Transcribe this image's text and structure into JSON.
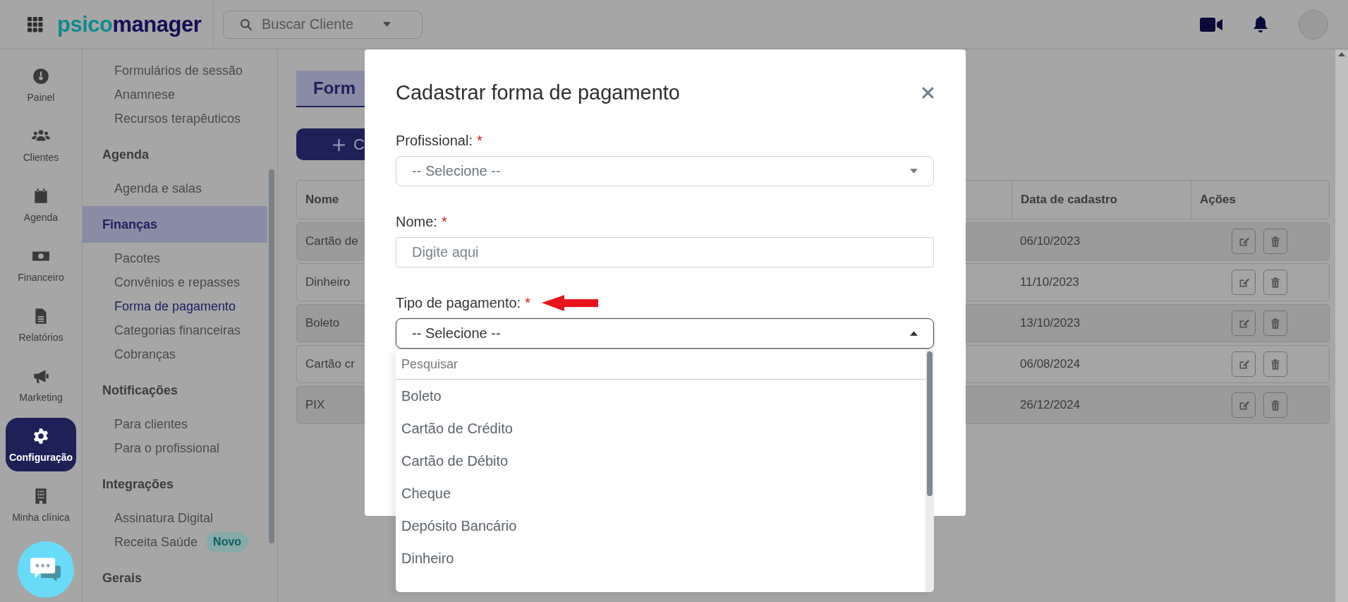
{
  "topbar": {
    "logo_part1": "psico",
    "logo_part2": "manager",
    "search": {
      "placeholder": "Buscar Cliente"
    }
  },
  "nav_rail": [
    {
      "label": "Painel",
      "selected": false
    },
    {
      "label": "Clientes",
      "selected": false
    },
    {
      "label": "Agenda",
      "selected": false
    },
    {
      "label": "Financeiro",
      "selected": false
    },
    {
      "label": "Relatórios",
      "selected": false
    },
    {
      "label": "Marketing",
      "selected": false
    },
    {
      "label": "Configuração",
      "selected": true
    },
    {
      "label": "Minha clínica",
      "selected": false
    }
  ],
  "settings_menu": [
    {
      "kind": "item",
      "label": "Formulários de sessão",
      "selected": false
    },
    {
      "kind": "item",
      "label": "Anamnese",
      "selected": false
    },
    {
      "kind": "item",
      "label": "Recursos terapêuticos",
      "selected": false
    },
    {
      "kind": "heading",
      "label": "Agenda",
      "selected": false
    },
    {
      "kind": "item",
      "label": "Agenda e salas",
      "selected": false
    },
    {
      "kind": "heading",
      "label": "Finanças",
      "selected": true
    },
    {
      "kind": "item",
      "label": "Pacotes",
      "selected": false
    },
    {
      "kind": "item",
      "label": "Convênios e repasses",
      "selected": false
    },
    {
      "kind": "item",
      "label": "Forma de pagamento",
      "selected": true
    },
    {
      "kind": "item",
      "label": "Categorias financeiras",
      "selected": false
    },
    {
      "kind": "item",
      "label": "Cobranças",
      "selected": false
    },
    {
      "kind": "heading",
      "label": "Notificações",
      "selected": false
    },
    {
      "kind": "item",
      "label": "Para clientes",
      "selected": false
    },
    {
      "kind": "item",
      "label": "Para o profissional",
      "selected": false
    },
    {
      "kind": "heading",
      "label": "Integrações",
      "selected": false
    },
    {
      "kind": "item",
      "label": "Assinatura Digital",
      "selected": false
    },
    {
      "kind": "item",
      "label": "Receita Saúde",
      "selected": false,
      "badge": "Novo"
    },
    {
      "kind": "heading",
      "label": "Gerais",
      "selected": false
    }
  ],
  "page": {
    "title": "Form",
    "new_button": "C",
    "table": {
      "columns": [
        "Nome",
        "Data de cadastro",
        "Ações"
      ],
      "rows": [
        {
          "name": "Cartão de",
          "date": "06/10/2023"
        },
        {
          "name": "Dinheiro",
          "date": "11/10/2023"
        },
        {
          "name": "Boleto",
          "date": "13/10/2023"
        },
        {
          "name": "Cartão cr",
          "date": "06/08/2024"
        },
        {
          "name": "PIX",
          "date": "26/12/2024"
        }
      ]
    }
  },
  "modal": {
    "title": "Cadastrar forma de pagamento",
    "fields": [
      {
        "kind": "select",
        "label": "Profissional:",
        "required_mark": "*",
        "placeholder": "-- Selecione --",
        "expanded": false
      },
      {
        "kind": "text",
        "label": "Nome:",
        "required_mark": "*",
        "placeholder": "Digite aqui"
      },
      {
        "kind": "select",
        "label": "Tipo de pagamento:",
        "required_mark": "*",
        "value": "-- Selecione --",
        "expanded": true,
        "search_placeholder": "Pesquisar",
        "options": [
          "Boleto",
          "Cartão de Crédito",
          "Cartão de Débito",
          "Cheque",
          "Depósito Bancário",
          "Dinheiro"
        ]
      }
    ]
  }
}
